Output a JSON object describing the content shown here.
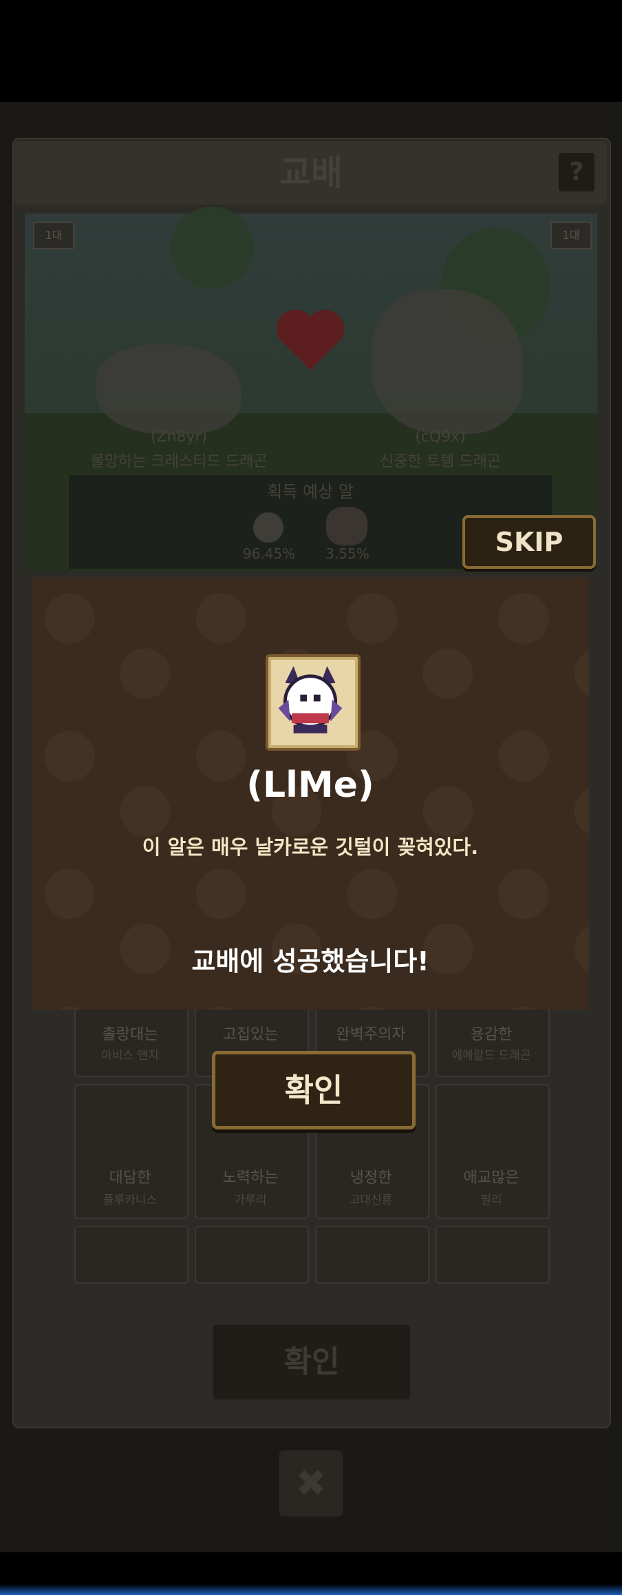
{
  "header": {
    "title": "교배",
    "help_icon": "?"
  },
  "scene": {
    "left_tag": "1대",
    "right_tag": "1대",
    "left_parent": {
      "code": "(Zn8yr)",
      "name": "물망하는 크레스티드 드래곤"
    },
    "right_parent": {
      "code": "(cQ9x)",
      "name": "신중한 토템 드래곤"
    },
    "expected_eggs_label": "획득 예상 알",
    "egg_chances": [
      "96.45%",
      "3.55%"
    ]
  },
  "skip_button": "SKIP",
  "result": {
    "name": "(LlMe)",
    "description": "이 알은 매우 날카로운 깃털이 꽂혀있다.",
    "message": "교배에 성공했습니다!"
  },
  "confirm_button": "확인",
  "grid_cards": [
    {
      "title": "촐랑대는",
      "sub": "아비스 앤지"
    },
    {
      "title": "고집있는",
      "sub": ""
    },
    {
      "title": "완벽주의자",
      "sub": ""
    },
    {
      "title": "용감한",
      "sub": "에메랄드 드래곤"
    },
    {
      "title": "대담한",
      "sub": "플루카니스"
    },
    {
      "title": "노력하는",
      "sub": "가루리"
    },
    {
      "title": "냉정한",
      "sub": "고대신룡"
    },
    {
      "title": "애교많은",
      "sub": "필리"
    }
  ],
  "bottom_confirm": "확인",
  "close_icon": "✖",
  "colors": {
    "accent": "#8a6a34",
    "modal_bg": "#3b2b1e",
    "background": "#000000"
  }
}
